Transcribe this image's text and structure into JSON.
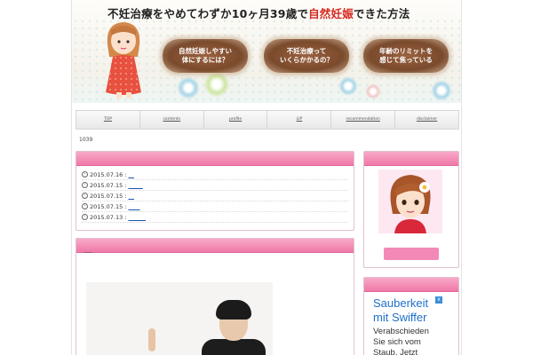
{
  "header": {
    "title_prefix": "不妊治療をやめてわずか10ヶ月39歳で",
    "title_highlight": "自然妊娠",
    "title_suffix": "できた方法",
    "buttons": [
      {
        "line1": "自然妊娠しやすい",
        "line2": "体にするには？"
      },
      {
        "line1": "不妊治療って",
        "line2": "いくらかかるの？"
      },
      {
        "line1": "年齢のリミットを",
        "line2": "感じて焦っている"
      }
    ]
  },
  "nav": [
    "TOP",
    "contents",
    "profile",
    "LIP",
    "recommendation",
    "disclaimer"
  ],
  "breadcrumb": "1039",
  "news": [
    {
      "date": "2015.07.16 :",
      "link": "__"
    },
    {
      "date": "2015.07.15 :",
      "link": "_____"
    },
    {
      "date": "2015.07.15 :",
      "link": "__"
    },
    {
      "date": "2015.07.15 :",
      "link": "____"
    },
    {
      "date": "2015.07.13 :",
      "link": "______"
    }
  ],
  "post": {
    "heading": "___"
  },
  "ad": {
    "headline_1": "Sauberkeit",
    "headline_2": "mit Swiffer",
    "body_1": "Verabschieden",
    "body_2": "Sie sich vom",
    "body_3": "Staub. Jetzt",
    "close": "x"
  },
  "colors": {
    "accent_pink": "#ef79a8",
    "title_red": "#d4281f",
    "pill_brown": "#8a5436"
  }
}
